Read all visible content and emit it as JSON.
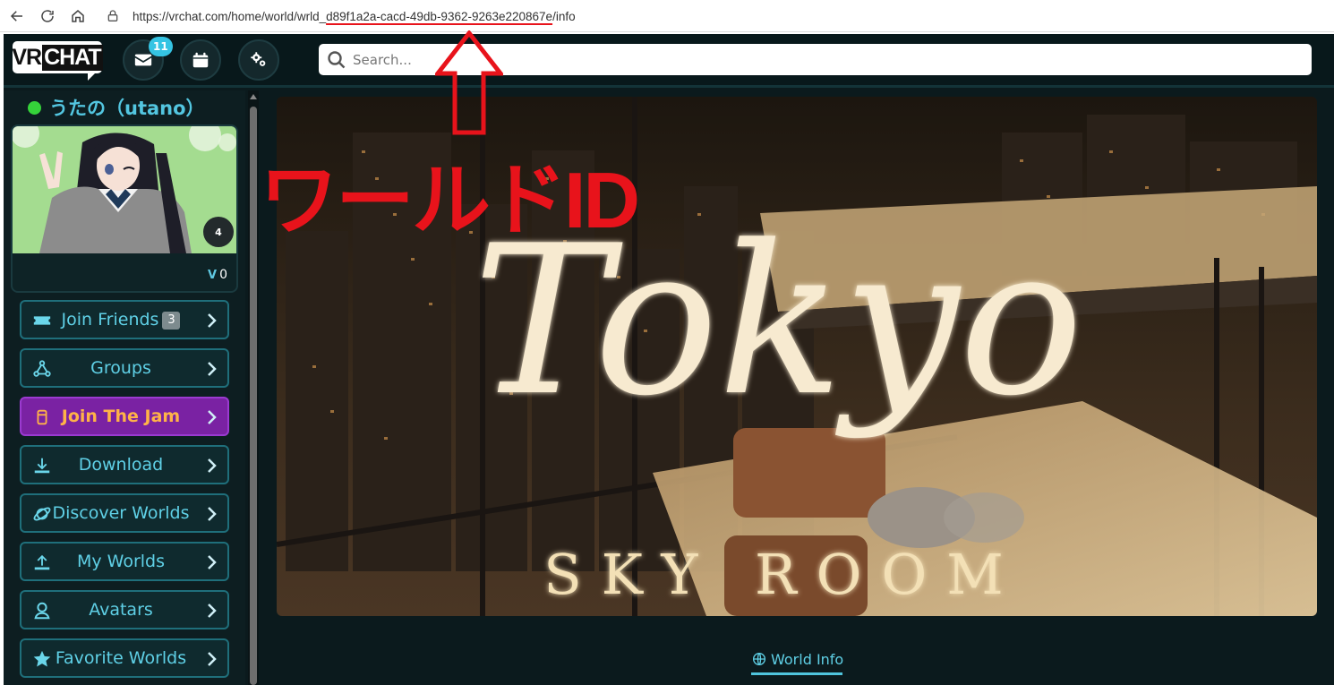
{
  "browser": {
    "url_prefix": "https://vrchat.com/home/world/wrld_",
    "url_id": "d89f1a2a-cacd-49db-9362-9263e220867e",
    "url_suffix": "/info"
  },
  "header": {
    "logo_text_a": "VR",
    "logo_text_b": "CHAT",
    "notification_count": "11",
    "search_placeholder": "Search..."
  },
  "user": {
    "display_name": "うたの（utano）",
    "avatar_badge": "4",
    "vrc_credits": "0"
  },
  "sidebar": {
    "items": [
      {
        "label": "Join Friends",
        "count": "3",
        "icon": "ticket-icon"
      },
      {
        "label": "Groups",
        "icon": "groups-icon"
      },
      {
        "label": "Join The Jam",
        "icon": "jam-icon"
      },
      {
        "label": "Download",
        "icon": "download-icon"
      },
      {
        "label": "Discover Worlds",
        "icon": "planet-icon"
      },
      {
        "label": "My Worlds",
        "icon": "upload-icon"
      },
      {
        "label": "Avatars",
        "icon": "avatar-icon"
      },
      {
        "label": "Favorite Worlds",
        "icon": "star-icon"
      }
    ]
  },
  "world": {
    "title_script": "Tokyo",
    "subtitle": "SKY ROOM"
  },
  "tabs": {
    "world_info": "World Info"
  },
  "annotation": {
    "text": "ワールドID",
    "color": "#e8131b"
  },
  "colors": {
    "accent": "#53c6e0",
    "app_bg": "#0b1a1d",
    "jam_bg": "#7a22a3",
    "jam_text": "#ffb347",
    "online": "#35d33a"
  }
}
